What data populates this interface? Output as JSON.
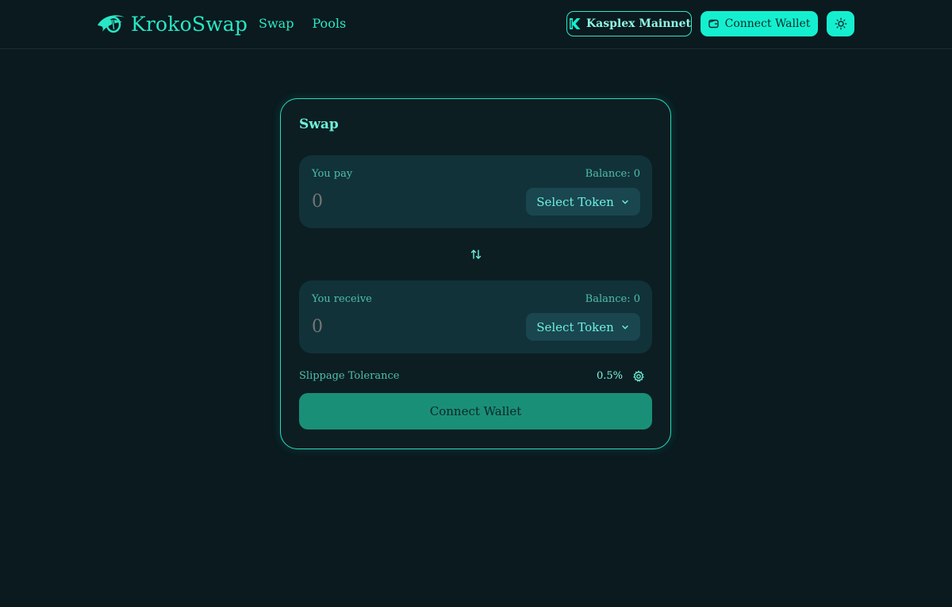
{
  "header": {
    "brand": "KrokoSwap",
    "nav": [
      {
        "label": "Swap"
      },
      {
        "label": "Pools"
      }
    ],
    "network_label": "Kasplex Mainnet",
    "connect_label": "Connect Wallet",
    "theme_icon": "sun-icon"
  },
  "swap": {
    "title": "Swap",
    "pay": {
      "label": "You pay",
      "balance": "Balance: 0",
      "amount_placeholder": "0",
      "token_label": "Select Token"
    },
    "switch_icon": "swap-arrows-icon",
    "receive": {
      "label": "You receive",
      "balance": "Balance: 0",
      "amount_placeholder": "0",
      "token_label": "Select Token"
    },
    "slippage_label": "Slippage Tolerance",
    "slippage_value": "0.5%",
    "connect_label": "Connect Wallet"
  },
  "colors": {
    "background": "#0a1a1f",
    "accent": "#14f0cf",
    "card_border": "#2bd9bb",
    "panel": "#113239",
    "primary_button": "#1a8f78"
  }
}
